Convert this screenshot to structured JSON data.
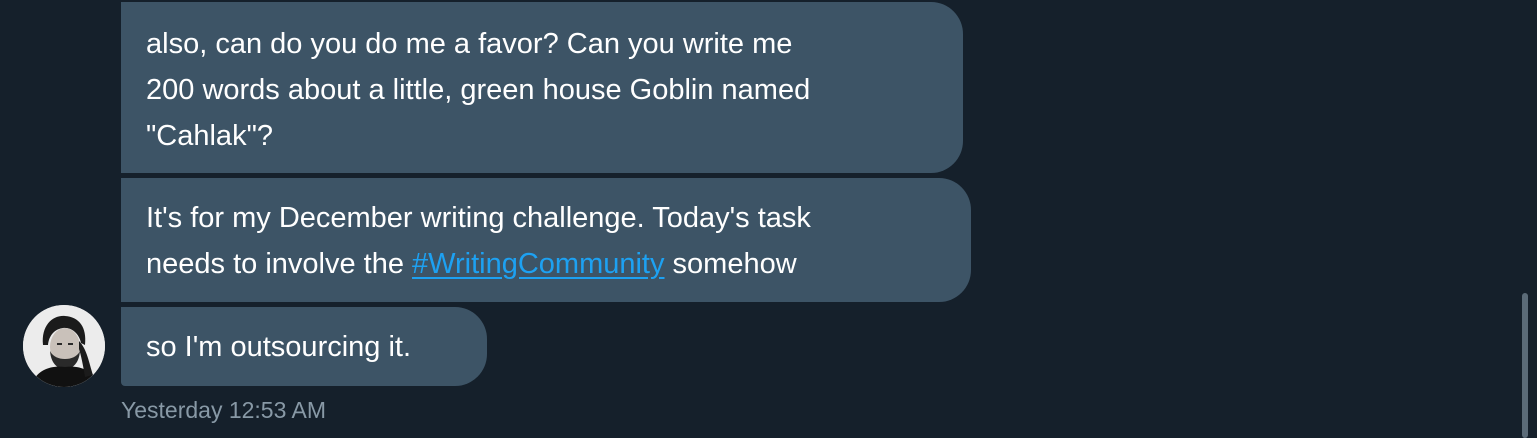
{
  "messages": [
    {
      "lines": [
        "also, can do you do me a favor? Can you write me",
        "200 words about a little, green house Goblin named",
        "\"Cahlak\"?"
      ]
    },
    {
      "line1": "It's for my December writing challenge. Today's task",
      "line2_before": "needs to involve the ",
      "line2_hashtag": "#WritingCommunity",
      "line2_after": " somehow"
    },
    {
      "text": "so I'm outsourcing it."
    }
  ],
  "timestamp": "Yesterday 12:53 AM",
  "colors": {
    "background": "#15202b",
    "bubble": "#3d5466",
    "link": "#1da1f2",
    "timestamp": "#8899a6"
  },
  "avatar": {
    "icon": "user-avatar-photo"
  }
}
